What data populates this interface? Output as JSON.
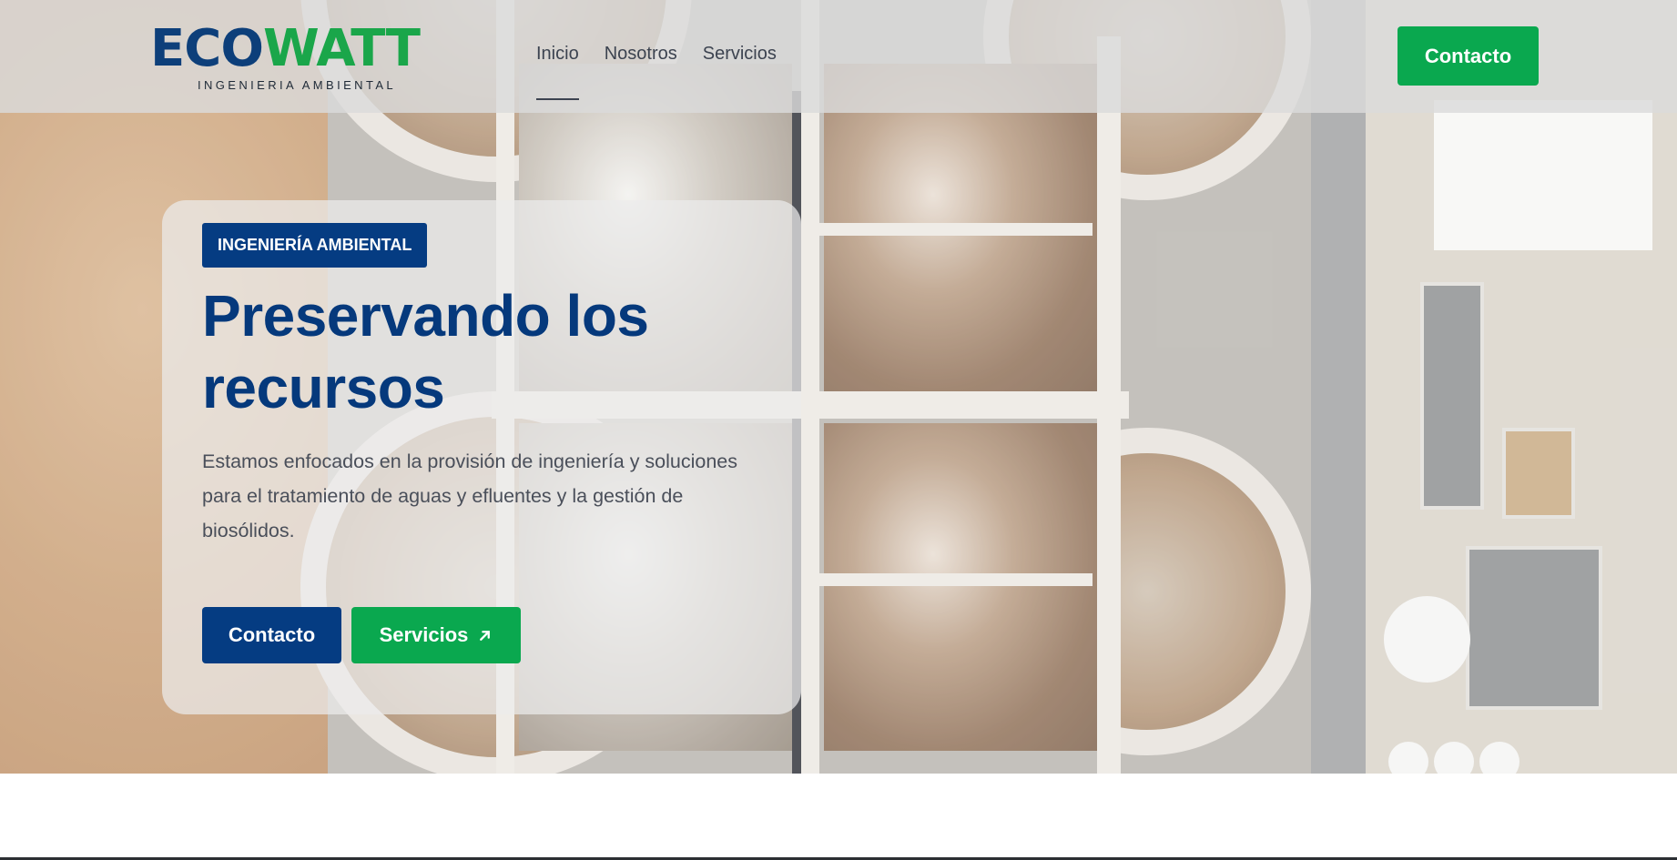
{
  "brand": {
    "logo_word_part1": "ECO",
    "logo_word_part2": "WATT",
    "logo_subtitle": "INGENIERIA AMBIENTAL",
    "color_primary": "#053c82",
    "color_accent": "#0aa84f"
  },
  "nav": {
    "items": [
      {
        "label": "Inicio",
        "active": true
      },
      {
        "label": "Nosotros",
        "active": false
      },
      {
        "label": "Servicios",
        "active": false
      }
    ],
    "cta_label": "Contacto"
  },
  "hero": {
    "badge": "INGENIERÍA AMBIENTAL",
    "title_line1": "Preservando los",
    "title_line2": "recursos",
    "description": "Estamos enfocados en la provisión de ingeniería y soluciones para el tratamiento de aguas y efluentes y la gestión de biosólidos.",
    "primary_button": "Contacto",
    "secondary_button": "Servicios",
    "secondary_button_icon": "arrow-up-right-icon",
    "background_image": "aerial-water-treatment-plant"
  }
}
